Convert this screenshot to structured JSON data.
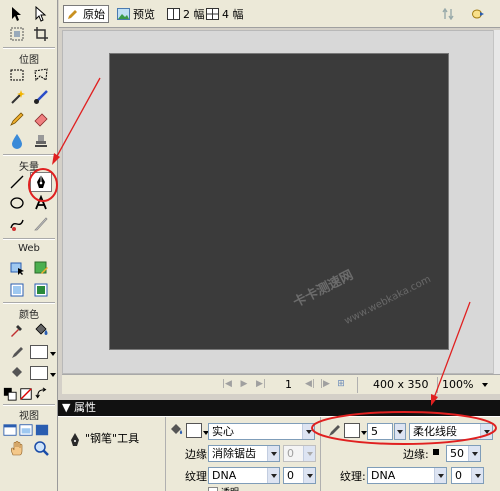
{
  "toolbar": {
    "sections": {
      "bitmap": "位图",
      "vector": "矢量",
      "web": "Web",
      "colors": "颜色",
      "view": "视图"
    },
    "selected_tool": "pen-icon"
  },
  "viewbar": {
    "tabs": [
      {
        "label": "原始",
        "active": true
      },
      {
        "label": "预览",
        "active": false
      },
      {
        "label": "2 幅",
        "active": false
      },
      {
        "label": "4 幅",
        "active": false
      }
    ]
  },
  "navbar": {
    "frame": "1",
    "canvas_size": "400 x 350",
    "zoom": "100%"
  },
  "properties": {
    "title": "▼ 属性",
    "tool_name": "\"钢笔\"工具",
    "fill_type": "实心",
    "edge_label": "边缘:",
    "edge_value": "消除锯齿",
    "edge_amount": "0",
    "texture_label": "纹理:",
    "texture_value": "DNA",
    "texture_amount": "0",
    "stroke_size": "5",
    "stroke_type": "柔化线段",
    "stroke_edge_label": "边缘:",
    "stroke_edge_value": "50",
    "stroke_texture_label": "纹理:",
    "stroke_texture_value": "DNA",
    "stroke_texture_amount": "0",
    "transparent_label": "透明"
  },
  "watermark": {
    "text": "卡卡测速网",
    "url": "www.webkaka.com"
  },
  "colors": {
    "annotation": "#e02020",
    "stage": "#3b3b3b",
    "panel": "#ece9d8"
  }
}
